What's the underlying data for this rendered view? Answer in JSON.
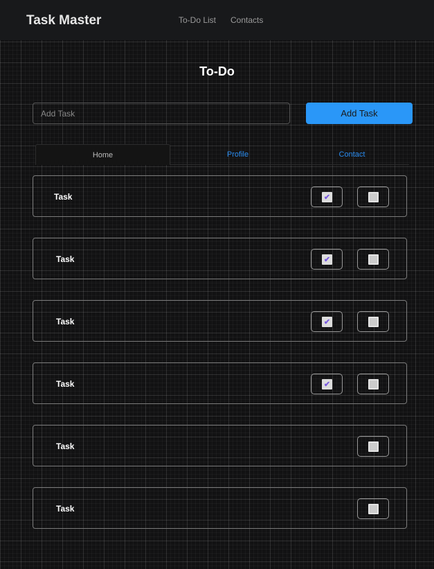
{
  "nav": {
    "brand": "Task Master",
    "links": [
      "To-Do List",
      "Contacts"
    ]
  },
  "title": "To-Do",
  "input": {
    "placeholder": "Add Task",
    "value": ""
  },
  "add_button": "Add Task",
  "tabs": [
    "Home",
    "Profile",
    "Contact"
  ],
  "tasks": [
    {
      "name": "Task",
      "done_button": true
    },
    {
      "name": "Task",
      "done_button": true
    },
    {
      "name": "Task",
      "done_button": true
    },
    {
      "name": "Task",
      "done_button": true
    },
    {
      "name": "Task",
      "done_button": false
    },
    {
      "name": "Task",
      "done_button": false
    }
  ],
  "icons": {
    "check": "✔"
  }
}
